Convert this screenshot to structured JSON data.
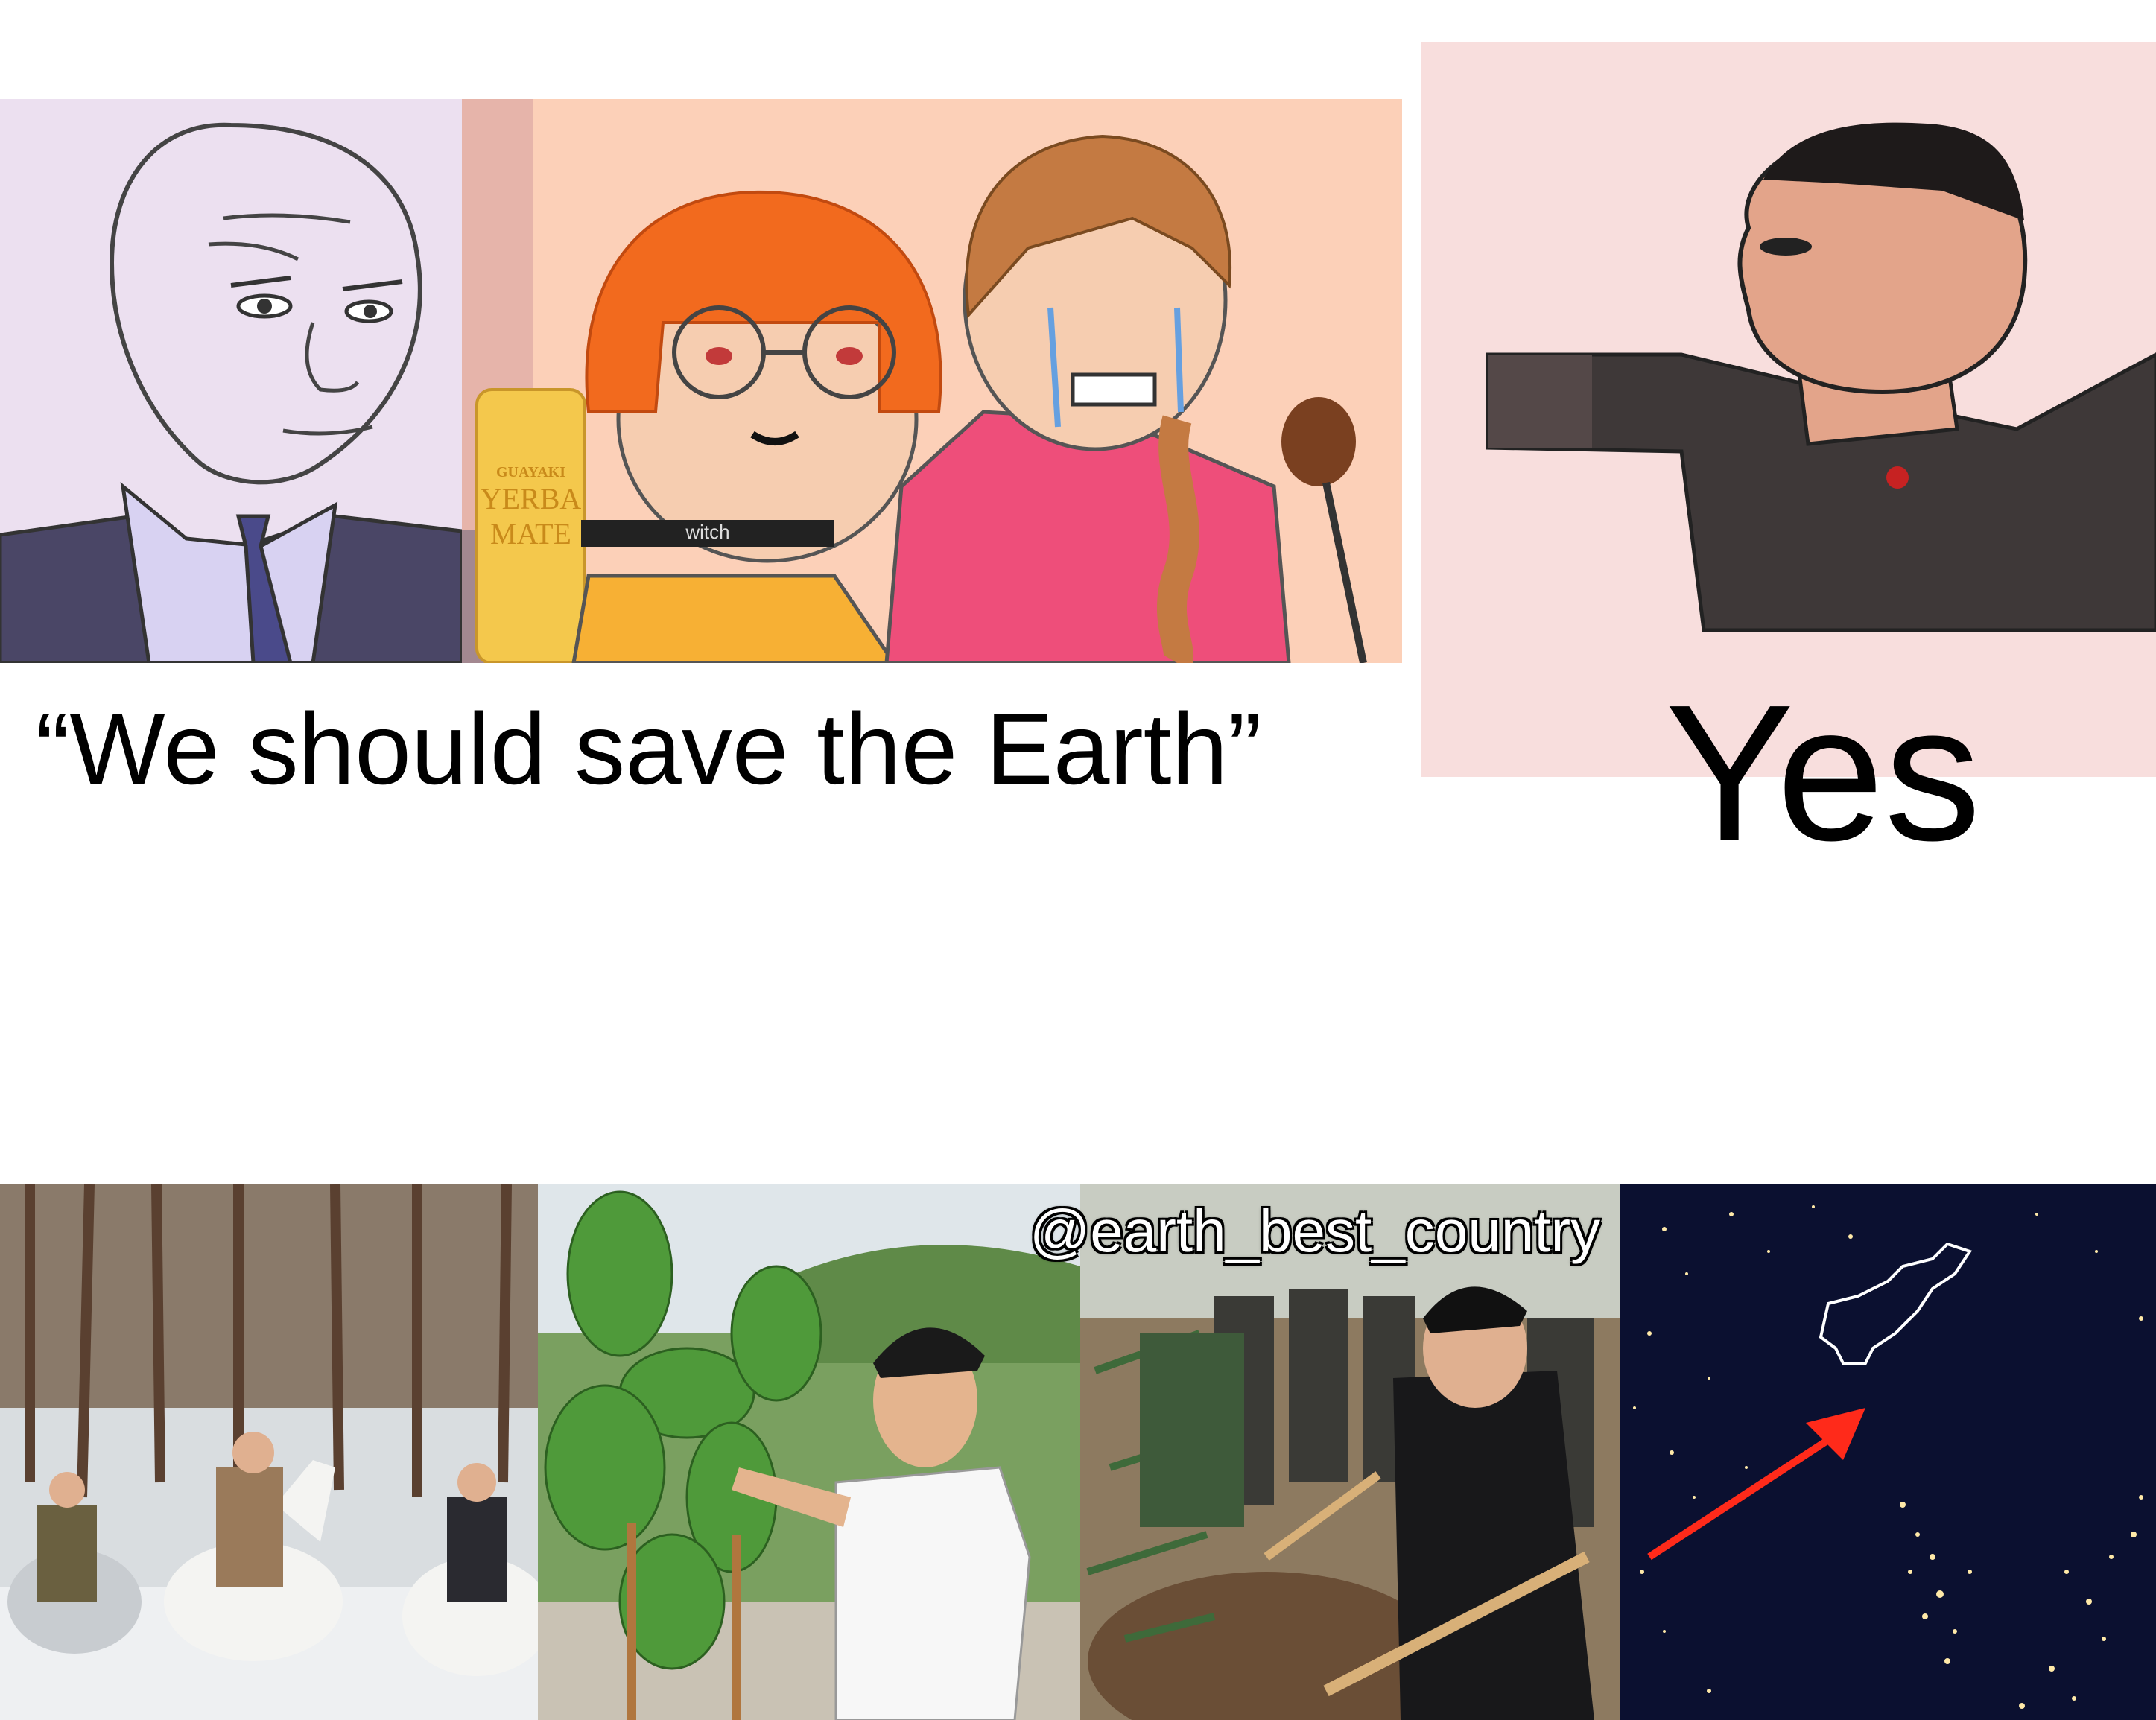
{
  "meme": {
    "left_caption": "“We should save the Earth”",
    "right_caption": "Yes",
    "watermark": "@earth_best_country",
    "panels": {
      "wojak_text": "",
      "can_label_line1": "GUAYAKI",
      "can_label_line2": "YERBA",
      "can_label_line3": "MATE",
      "choker_text": "witch"
    }
  },
  "colors": {
    "wojak_bg": "#ece0f0",
    "girls_bg": "#fcd0b8",
    "yes_bg": "#f8dedd",
    "snow": "#eef0f2",
    "night": "#0b1030",
    "arrow": "#ff2a1a"
  }
}
